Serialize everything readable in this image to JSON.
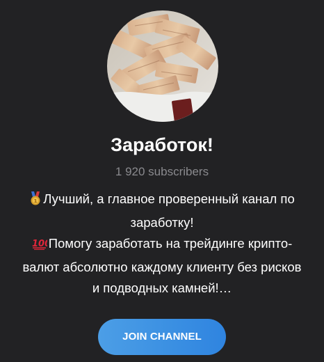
{
  "channel": {
    "title": "Заработок!",
    "subscribers": "1 920 subscribers",
    "avatar_icon": "money-stacks-photo"
  },
  "description": {
    "lines": [
      "Лучший, а главное проверенный канал по",
      "заработку!",
      "Помогу заработать на трейдинге крипто-",
      "валют абсолютно каждому клиенту без рисков",
      "и подводных камней!…"
    ],
    "emoji_1": "medal-icon",
    "emoji_2": "hundred-points-icon"
  },
  "join_button": {
    "label": "JOIN CHANNEL"
  },
  "colors": {
    "background": "#222224",
    "title": "#ffffff",
    "subscribers": "#8a8a8e",
    "button": "#3a8fe2"
  }
}
